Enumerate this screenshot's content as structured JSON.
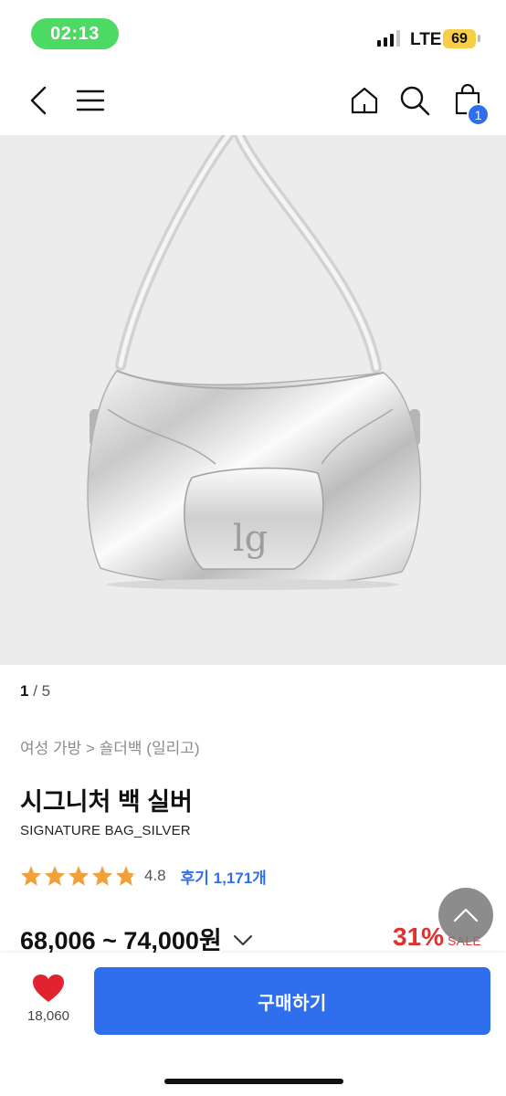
{
  "status_bar": {
    "time": "02:13",
    "network": "LTE",
    "battery": "69"
  },
  "nav": {
    "cart_count": "1"
  },
  "gallery": {
    "current": "1",
    "separator": " / ",
    "total": "5",
    "logo_text": "lg"
  },
  "product": {
    "breadcrumb": "여성 가방 > 숄더백 (일리고)",
    "title_ko": "시그니처 백 실버",
    "title_en": "SIGNATURE BAG_SILVER",
    "rating": 4.8,
    "rating_text": "4.8",
    "review_label": "후기 1,171개",
    "price": "68,006 ~ 74,000원",
    "discount": "31%",
    "sale_label": "SALE"
  },
  "bottom_bar": {
    "wish_count": "18,060",
    "buy_label": "구매하기"
  },
  "colors": {
    "accent": "#2f6fed",
    "sale": "#e03131",
    "star": "#f0a13a",
    "heart": "#e0232e",
    "time_pill": "#4cd964"
  },
  "icons": [
    "back-icon",
    "menu-icon",
    "home-icon",
    "search-icon",
    "shopping-bag-icon",
    "star-icon",
    "chevron-down-icon",
    "chevron-up-icon",
    "heart-icon"
  ]
}
